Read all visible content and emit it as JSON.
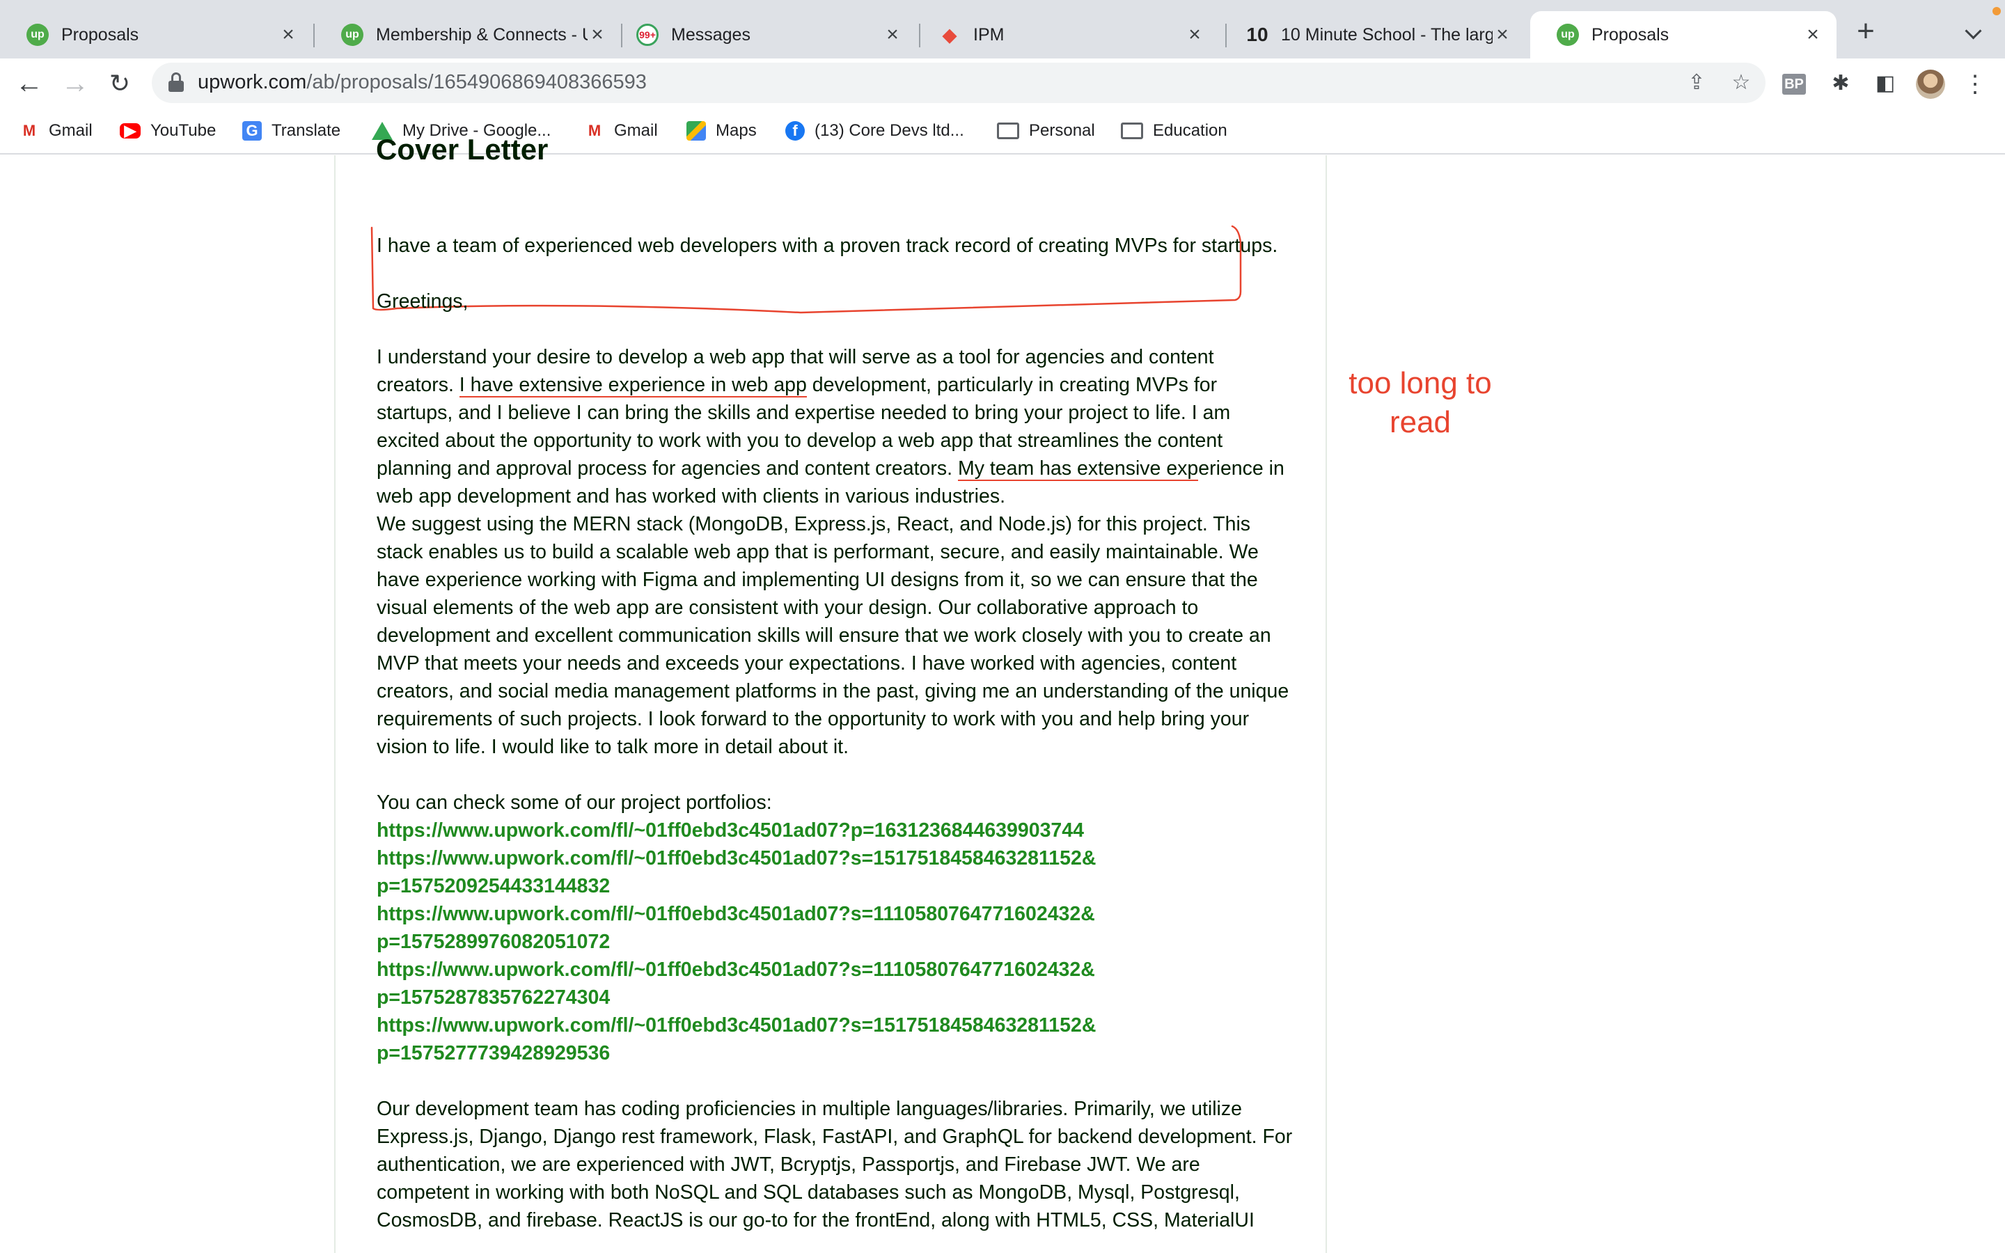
{
  "browser": {
    "tabs": [
      {
        "title": "Proposals",
        "icon": "upwork-icon",
        "active": false
      },
      {
        "title": "Membership & Connects - U",
        "icon": "upwork-icon",
        "active": false
      },
      {
        "title": "Messages",
        "icon": "messages-icon",
        "active": false
      },
      {
        "title": "IPM",
        "icon": "ipm-icon",
        "active": false
      },
      {
        "title": "10 Minute School - The larg",
        "icon": "ten-minute-school-icon",
        "active": false
      },
      {
        "title": "Proposals",
        "icon": "upwork-icon",
        "active": true
      }
    ],
    "favicon_text": {
      "upwork": "up",
      "messages": "99+",
      "ipm": "◆",
      "ten_minute": "10"
    },
    "url_host": "upwork.com",
    "url_path": "/ab/proposals/1654906869408366593",
    "extensions": {
      "bp_label": "BP"
    },
    "bookmarks": [
      {
        "label": "Gmail",
        "icon": "gmail-icon",
        "glyph": "M"
      },
      {
        "label": "YouTube",
        "icon": "youtube-icon",
        "glyph": "▶"
      },
      {
        "label": "Translate",
        "icon": "translate-icon",
        "glyph": "G"
      },
      {
        "label": "My Drive - Google...",
        "icon": "google-drive-icon",
        "glyph": ""
      },
      {
        "label": "Gmail",
        "icon": "gmail-icon",
        "glyph": "M"
      },
      {
        "label": "Maps",
        "icon": "maps-icon",
        "glyph": ""
      },
      {
        "label": "(13) Core Devs ltd...",
        "icon": "facebook-icon",
        "glyph": "f"
      },
      {
        "label": "Personal",
        "icon": "folder-icon",
        "glyph": ""
      },
      {
        "label": "Education",
        "icon": "folder-icon",
        "glyph": ""
      }
    ]
  },
  "content": {
    "section_heading": "Cover Letter",
    "intro": "I have a team of experienced web developers with a proven track record of creating MVPs for startups.",
    "greeting": "Greetings,",
    "paragraph1_a": "I understand your desire to develop a web app that will serve as a tool for agencies and content creators. ",
    "paragraph1_u1": "I have extensive experience in web app",
    "paragraph1_b": " development, particularly in creating MVPs for startups, and I believe I can bring the skills and expertise needed to bring your project to life. I am excited about the opportunity to work with you to develop a web app that streamlines the content planning and approval process for agencies and content creators. ",
    "paragraph1_u2": "My team has extensive exp",
    "paragraph1_c": "erience in web app development and has worked with clients in various industries.",
    "paragraph2": "We suggest using the MERN stack (MongoDB, Express.js, React, and Node.js) for this project. This stack enables us to build a scalable web app that is performant, secure, and easily maintainable. We have experience working with Figma and implementing UI designs from it, so we can ensure that the visual elements of the web app are consistent with your design. Our collaborative approach to development and excellent communication skills will ensure that we work closely with you to create an MVP that meets your needs and exceeds your expectations. I have worked with agencies, content creators, and social media management platforms in the past, giving me an understanding of the unique requirements of such projects. I look forward to the opportunity to work with you and help bring your vision to life. I would like to talk more in detail about it.",
    "portfolio_intro": "You can check some of our project portfolios:",
    "portfolio_links": [
      "https://www.upwork.com/fl/~01ff0ebd3c4501ad07?p=1631236844639903744",
      "https://www.upwork.com/fl/~01ff0ebd3c4501ad07?s=1517518458463281152&p=1575209254433144832",
      "https://www.upwork.com/fl/~01ff0ebd3c4501ad07?s=1110580764771602432&p=1575289976082051072",
      "https://www.upwork.com/fl/~01ff0ebd3c4501ad07?s=1110580764771602432&p=1575287835762274304",
      "https://www.upwork.com/fl/~01ff0ebd3c4501ad07?s=1517518458463281152&p=1575277739428929536"
    ],
    "paragraph3": "Our development team has coding proficiencies in multiple languages/libraries. Primarily, we utilize Express.js, Django, Django rest framework, Flask, FastAPI, and GraphQL for backend development. For authentication, we are experienced with JWT, Bcryptjs, Passportjs, and Firebase JWT. We are competent in working with both NoSQL and SQL databases such as MongoDB, Mysql, Postgresql, CosmosDB, and firebase. ReactJS is our go-to for the frontEnd, along with HTML5, CSS, MaterialUI"
  },
  "annotation": {
    "note": "too long to read",
    "color": "#e8442f"
  },
  "colors": {
    "link": "#1f8a1f",
    "text": "#001e00",
    "upwork": "#4fab4a"
  }
}
